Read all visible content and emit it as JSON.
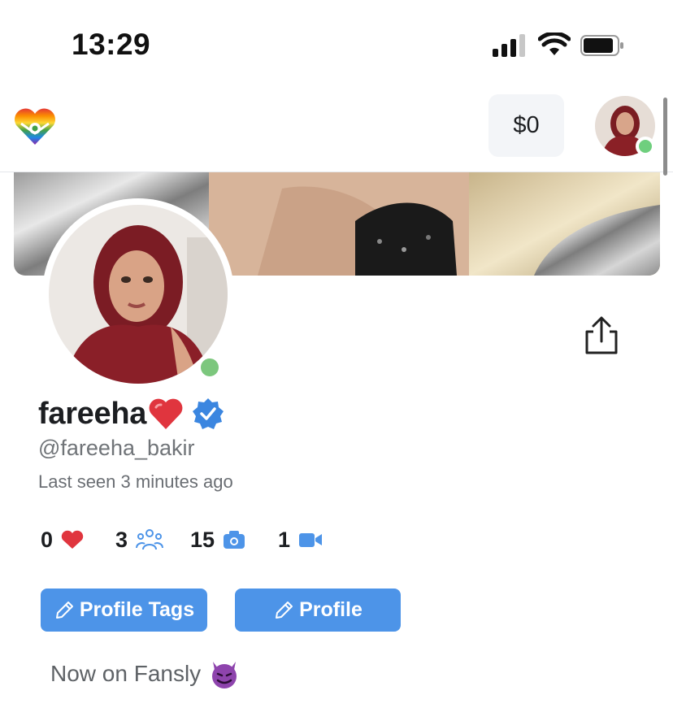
{
  "status_bar": {
    "time": "13:29"
  },
  "nav": {
    "balance": "$0",
    "logo_icon": "rainbow-heart-logo-icon",
    "online_color": "#6fcf7e"
  },
  "profile": {
    "display_name": "fareeha",
    "username": "@fareeha_bakir",
    "last_seen": "Last seen 3 minutes ago",
    "verified": true,
    "bio": "Now on Fansly"
  },
  "stats": [
    {
      "value": "0",
      "icon": "heart-icon"
    },
    {
      "value": "3",
      "icon": "people-icon"
    },
    {
      "value": "15",
      "icon": "camera-icon"
    },
    {
      "value": "1",
      "icon": "video-icon"
    }
  ],
  "actions": {
    "profile_tags_label": "Profile Tags",
    "profile_label": "Profile"
  },
  "colors": {
    "accent": "#4d94e8",
    "online": "#7cc77d",
    "heart": "#e0353e"
  }
}
